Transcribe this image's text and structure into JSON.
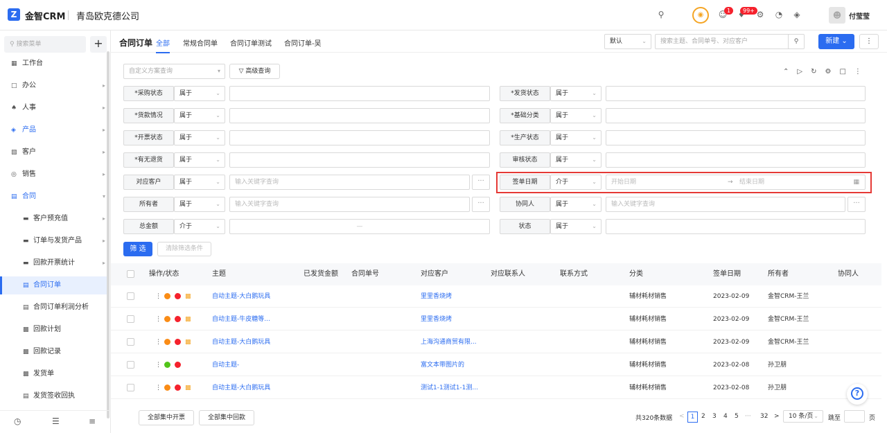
{
  "header": {
    "brand": "金智CRM",
    "company": "青岛欧克德公司",
    "badge1": "1",
    "badge2": "99+",
    "user": "付莹莹"
  },
  "sidebar": {
    "search_placeholder": "搜索菜单",
    "items": [
      {
        "label": "工作台",
        "icon": "dashboard-icon"
      },
      {
        "label": "办公",
        "icon": "office-icon"
      },
      {
        "label": "人事",
        "icon": "people-icon"
      },
      {
        "label": "产品",
        "icon": "product-icon"
      },
      {
        "label": "客户",
        "icon": "customer-icon"
      },
      {
        "label": "销售",
        "icon": "sales-icon"
      },
      {
        "label": "合同",
        "icon": "contract-icon"
      }
    ],
    "subitems": [
      {
        "label": "客户预充值"
      },
      {
        "label": "订单与发货产品"
      },
      {
        "label": "回款开票统计"
      },
      {
        "label": "合同订单"
      },
      {
        "label": "合同订单利润分析"
      },
      {
        "label": "回款计划"
      },
      {
        "label": "回款记录"
      },
      {
        "label": "发货单"
      },
      {
        "label": "发货签收回执"
      }
    ]
  },
  "tabs": {
    "title": "合同订单",
    "items": [
      "全部",
      "常规合同单",
      "合同订单测试",
      "合同订单-吴"
    ]
  },
  "toolbar": {
    "view": "默认",
    "search_placeholder": "搜索主题、合同单号、对应客户",
    "new": "新建"
  },
  "filter": {
    "scheme_placeholder": "自定义方案查询",
    "advanced": "高级查询",
    "filter_btn": "筛 选",
    "clear_btn": "清除筛选条件",
    "left": [
      {
        "label": "*采购状态",
        "op": "属于",
        "val": ""
      },
      {
        "label": "*货款情况",
        "op": "属于",
        "val": ""
      },
      {
        "label": "*开票状态",
        "op": "属于",
        "val": ""
      },
      {
        "label": "*有无退货",
        "op": "属于",
        "val": ""
      },
      {
        "label": "对应客户",
        "op": "属于",
        "val": "输入关键字查询"
      },
      {
        "label": "所有者",
        "op": "属于",
        "val": "输入关键字查询"
      },
      {
        "label": "总金额",
        "op": "介于",
        "val": "—"
      }
    ],
    "right": [
      {
        "label": "*发货状态",
        "op": "属于",
        "val": ""
      },
      {
        "label": "*基础分类",
        "op": "属于",
        "val": ""
      },
      {
        "label": "*生产状态",
        "op": "属于",
        "val": ""
      },
      {
        "label": "审核状态",
        "op": "属于",
        "val": ""
      },
      {
        "label": "签单日期",
        "op": "介于",
        "val": "开始日期",
        "val2": "结束日期"
      },
      {
        "label": "协同人",
        "op": "属于",
        "val": "输入关键字查询"
      },
      {
        "label": "状态",
        "op": "属于",
        "val": ""
      }
    ]
  },
  "table": {
    "headers": [
      "操作/状态",
      "主题",
      "已发货金额",
      "合同单号",
      "对应客户",
      "对应联系人",
      "联系方式",
      "分类",
      "签单日期",
      "所有者",
      "协同人"
    ],
    "rows": [
      {
        "subject": "自动主题-大白鹅玩具",
        "customer": "里里香烧烤",
        "category": "辅材耗材销售",
        "date": "2023-02-09",
        "owner": "金智CRM-王兰"
      },
      {
        "subject": "自动主题-牛皮糖等...",
        "customer": "里里香烧烤",
        "category": "辅材耗材销售",
        "date": "2023-02-09",
        "owner": "金智CRM-王兰"
      },
      {
        "subject": "自动主题-大白鹅玩具",
        "customer": "上海沟通商贸有限...",
        "category": "辅材耗材销售",
        "date": "2023-02-09",
        "owner": "金智CRM-王兰"
      },
      {
        "subject": "自动主题-",
        "customer": "富文本带图片的",
        "category": "辅材耗材销售",
        "date": "2023-02-08",
        "owner": "孙卫朋"
      },
      {
        "subject": "自动主题-大白鹅玩具",
        "customer": "测试1-1测试1-1测...",
        "category": "辅材耗材销售",
        "date": "2023-02-08",
        "owner": "孙卫朋"
      }
    ]
  },
  "footer": {
    "bulk_invoice": "全部集中开票",
    "bulk_payment": "全部集中回款",
    "total": "共320条数据",
    "pages": [
      "1",
      "2",
      "3",
      "4",
      "5"
    ],
    "last_page": "32",
    "per_page": "10 条/页",
    "goto": "跳至",
    "page_unit": "页"
  }
}
